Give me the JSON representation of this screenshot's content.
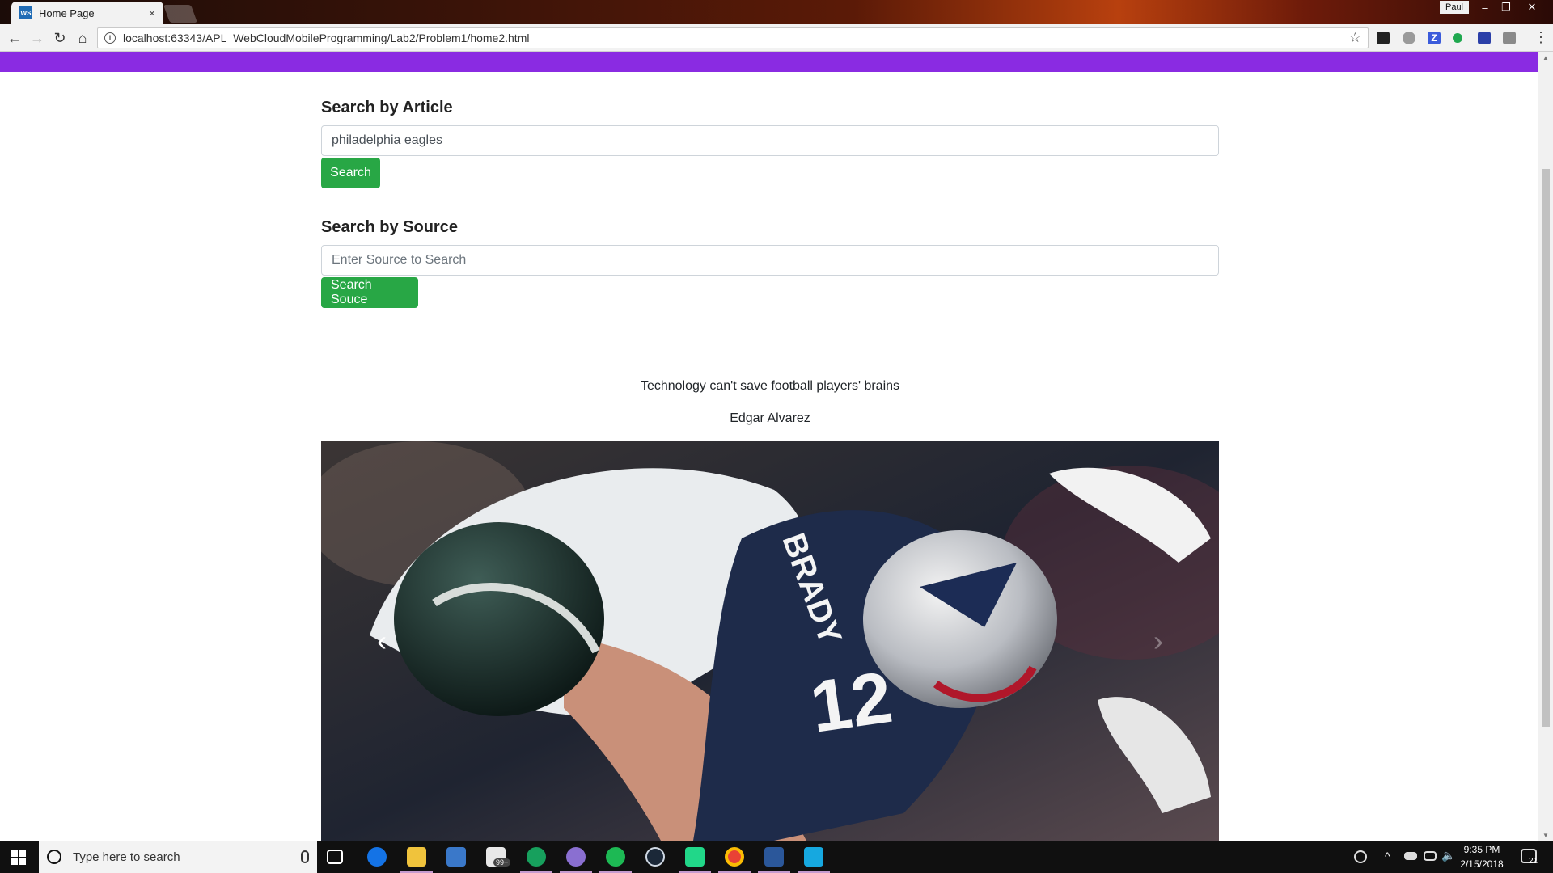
{
  "browser": {
    "tab_title": "Home Page",
    "tab_favicon_text": "WS",
    "tab_close": "×",
    "user_name": "Paul",
    "window_controls": {
      "minimize": "–",
      "restore": "❐",
      "close": "✕"
    },
    "nav": {
      "back": "←",
      "forward": "→",
      "reload": "↻",
      "home": "⌂"
    },
    "url": "localhost:63343/APL_WebCloudMobileProgramming/Lab2/Problem1/home2.html",
    "bookmark_star": "☆",
    "menu": "⋮",
    "extension_icons": [
      "ext-dark-icon",
      "ext-ghost-icon",
      "ext-z-icon",
      "ext-green-dot-icon",
      "ext-blue-icon",
      "ext-gray-icon"
    ]
  },
  "page": {
    "accent_bar_color": "#8a2be2",
    "article_search": {
      "title": "Search by Article",
      "input_value": "philadelphia eagles",
      "button_label": "Search"
    },
    "source_search": {
      "title": "Search by Source",
      "placeholder": "Enter Source to Search",
      "button_label": "Search Souce"
    },
    "article": {
      "headline": "Technology can't save football players' brains",
      "author": "Edgar Alvarez"
    },
    "carousel": {
      "prev": "‹",
      "next": "›",
      "image_alt": "Football tackle photo"
    }
  },
  "taskbar": {
    "search_placeholder": "Type here to search",
    "badge_count": "99+",
    "time": "9:35 PM",
    "date": "2/15/2018",
    "notification_count": "21",
    "pinned_apps": [
      "task-view-icon",
      "edge-icon",
      "file-explorer-icon",
      "store-icon",
      "mail-icon",
      "hangouts-icon",
      "purple-app-icon",
      "spotify-icon",
      "steam-icon",
      "pycharm-icon",
      "chrome-icon",
      "word-icon",
      "webstorm-icon"
    ]
  }
}
